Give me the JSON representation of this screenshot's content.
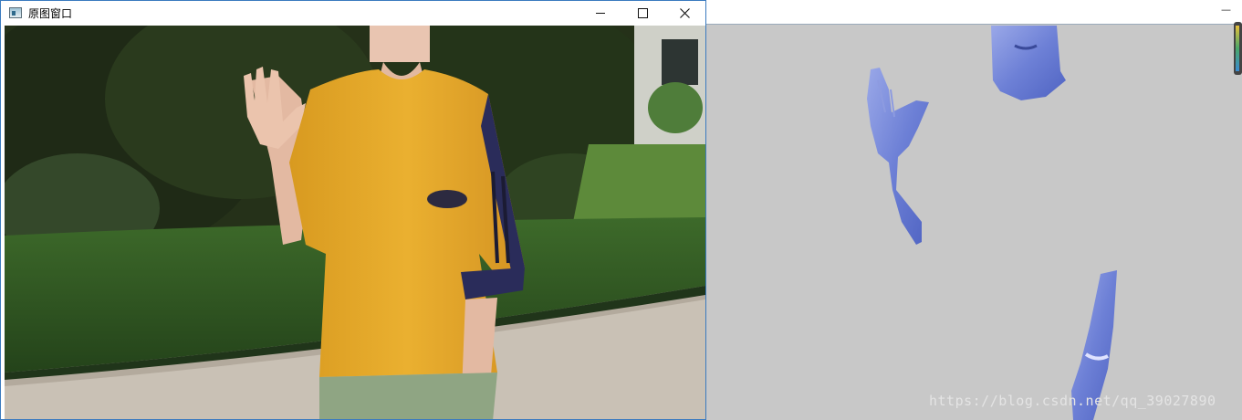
{
  "left_window": {
    "title": "原图窗口",
    "controls": {
      "minimize": "minimize",
      "maximize": "maximize",
      "close": "close"
    }
  },
  "right_window": {
    "watermark": "https://blog.csdn.net/qq_39027890"
  },
  "colors": {
    "background_gray": "#c8c8c8",
    "shirt_yellow": "#e8ad2a",
    "skin_mask_blue": "#6f82d8"
  }
}
